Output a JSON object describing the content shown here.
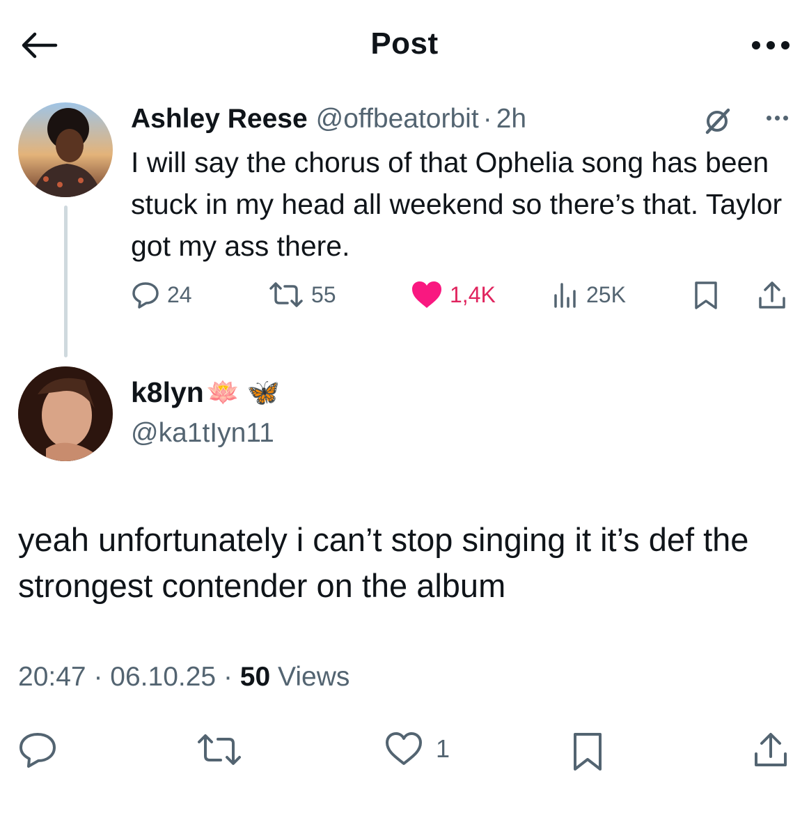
{
  "header": {
    "title": "Post"
  },
  "parent_tweet": {
    "name": "Ashley Reese",
    "handle": "@offbeatorbit",
    "separator": "·",
    "time": "2h",
    "text": "I will say the chorus of that Ophelia song has been stuck in my head all weekend so there’s that. Taylor got my ass there.",
    "replies": "24",
    "retweets": "55",
    "likes": "1,4K",
    "views": "25K"
  },
  "reply_tweet": {
    "name": "k8lyn",
    "name_emoji": "🪷 🦋",
    "handle": "@ka1tIyn11",
    "text": "yeah unfortunately i can’t stop singing it it’s def the strongest contender on the album",
    "time": "20:47",
    "date": "06.10.25",
    "separator": "·",
    "views_count": "50",
    "views_label": "Views",
    "likes": "1"
  },
  "colors": {
    "like": "#e0245e",
    "muted": "#536471",
    "text": "#0f1419",
    "thread_line": "#cfd9de"
  },
  "icons": [
    "back-arrow-icon",
    "more-icon",
    "grok-icon",
    "reply-icon",
    "retweet-icon",
    "heart-icon",
    "views-icon",
    "bookmark-icon",
    "share-icon"
  ]
}
